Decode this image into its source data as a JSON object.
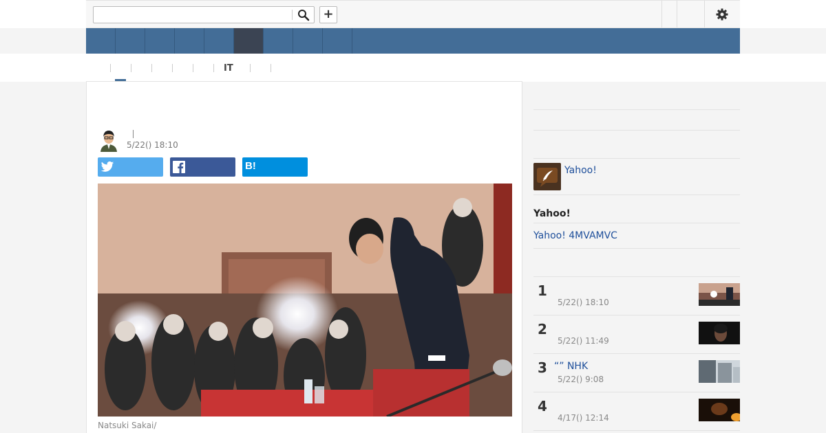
{
  "topbar": {
    "search_value": "",
    "search_placeholder": "",
    "plus_label": "+",
    "icons": [
      "search-icon",
      "plus-icon",
      "gear-icon"
    ]
  },
  "navbar": {
    "active_index": 5,
    "item_count": 9
  },
  "subnav": {
    "items": [
      "",
      "",
      "",
      "",
      "",
      "IT",
      "",
      ""
    ],
    "active_index": 0
  },
  "article": {
    "title": "",
    "author": "",
    "date": "5/22() 18:10",
    "share": {
      "twitter_icon": "twitter-icon",
      "facebook_icon": "facebook-icon",
      "hatena_label": "B!",
      "twitter_color": "#55acee",
      "facebook_color": "#3b5998",
      "hatena_color": "#008fde"
    },
    "caption": "Natsuki Sakai/"
  },
  "sidebar": {
    "yahoo_link": "Yahoo!",
    "yahoo_heading": "Yahoo!",
    "yahoo_sub_link": "Yahoo! 4MVAMVC",
    "ranking": [
      {
        "num": "1",
        "title": "",
        "date": "5/22() 18:10"
      },
      {
        "num": "2",
        "title": "",
        "date": "5/22() 11:49"
      },
      {
        "num": "3",
        "title": "“” NHK",
        "date": "5/22() 9:08"
      },
      {
        "num": "4",
        "title": "",
        "date": "4/17() 12:14"
      }
    ]
  },
  "colors": {
    "nav_blue": "#436d97",
    "nav_active": "#3b4453",
    "link_blue": "#1d4e9a"
  }
}
